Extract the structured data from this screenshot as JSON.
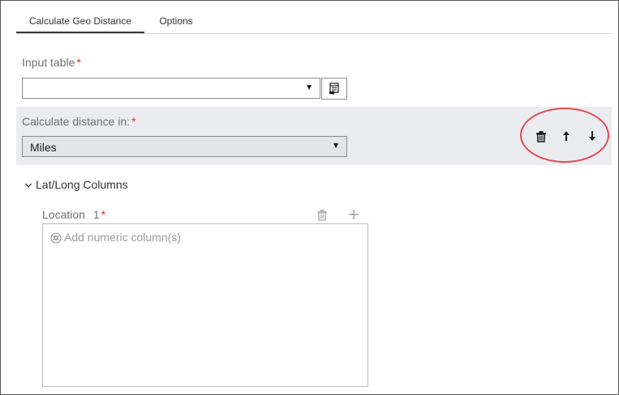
{
  "tabs": [
    {
      "label": "Calculate Geo Distance",
      "active": true
    },
    {
      "label": "Options",
      "active": false
    }
  ],
  "input_table": {
    "label": "Input table",
    "required_mark": "*",
    "value": ""
  },
  "distance_unit": {
    "label": "Calculate distance in:",
    "required_mark": "*",
    "value": "Miles"
  },
  "row_actions": {
    "icons": [
      "trash-icon",
      "arrow-up-icon",
      "arrow-down-icon"
    ],
    "highlight_color": "#e04a4f"
  },
  "lat_long_section": {
    "title": "Lat/Long Columns",
    "expanded": true,
    "location": {
      "label": "Location",
      "index": "1",
      "required_mark": "*",
      "add_placeholder": "Add numeric column(s)"
    }
  },
  "colors": {
    "band_background": "#ebecf0",
    "required": "#d0312d",
    "label": "#6e7075"
  }
}
